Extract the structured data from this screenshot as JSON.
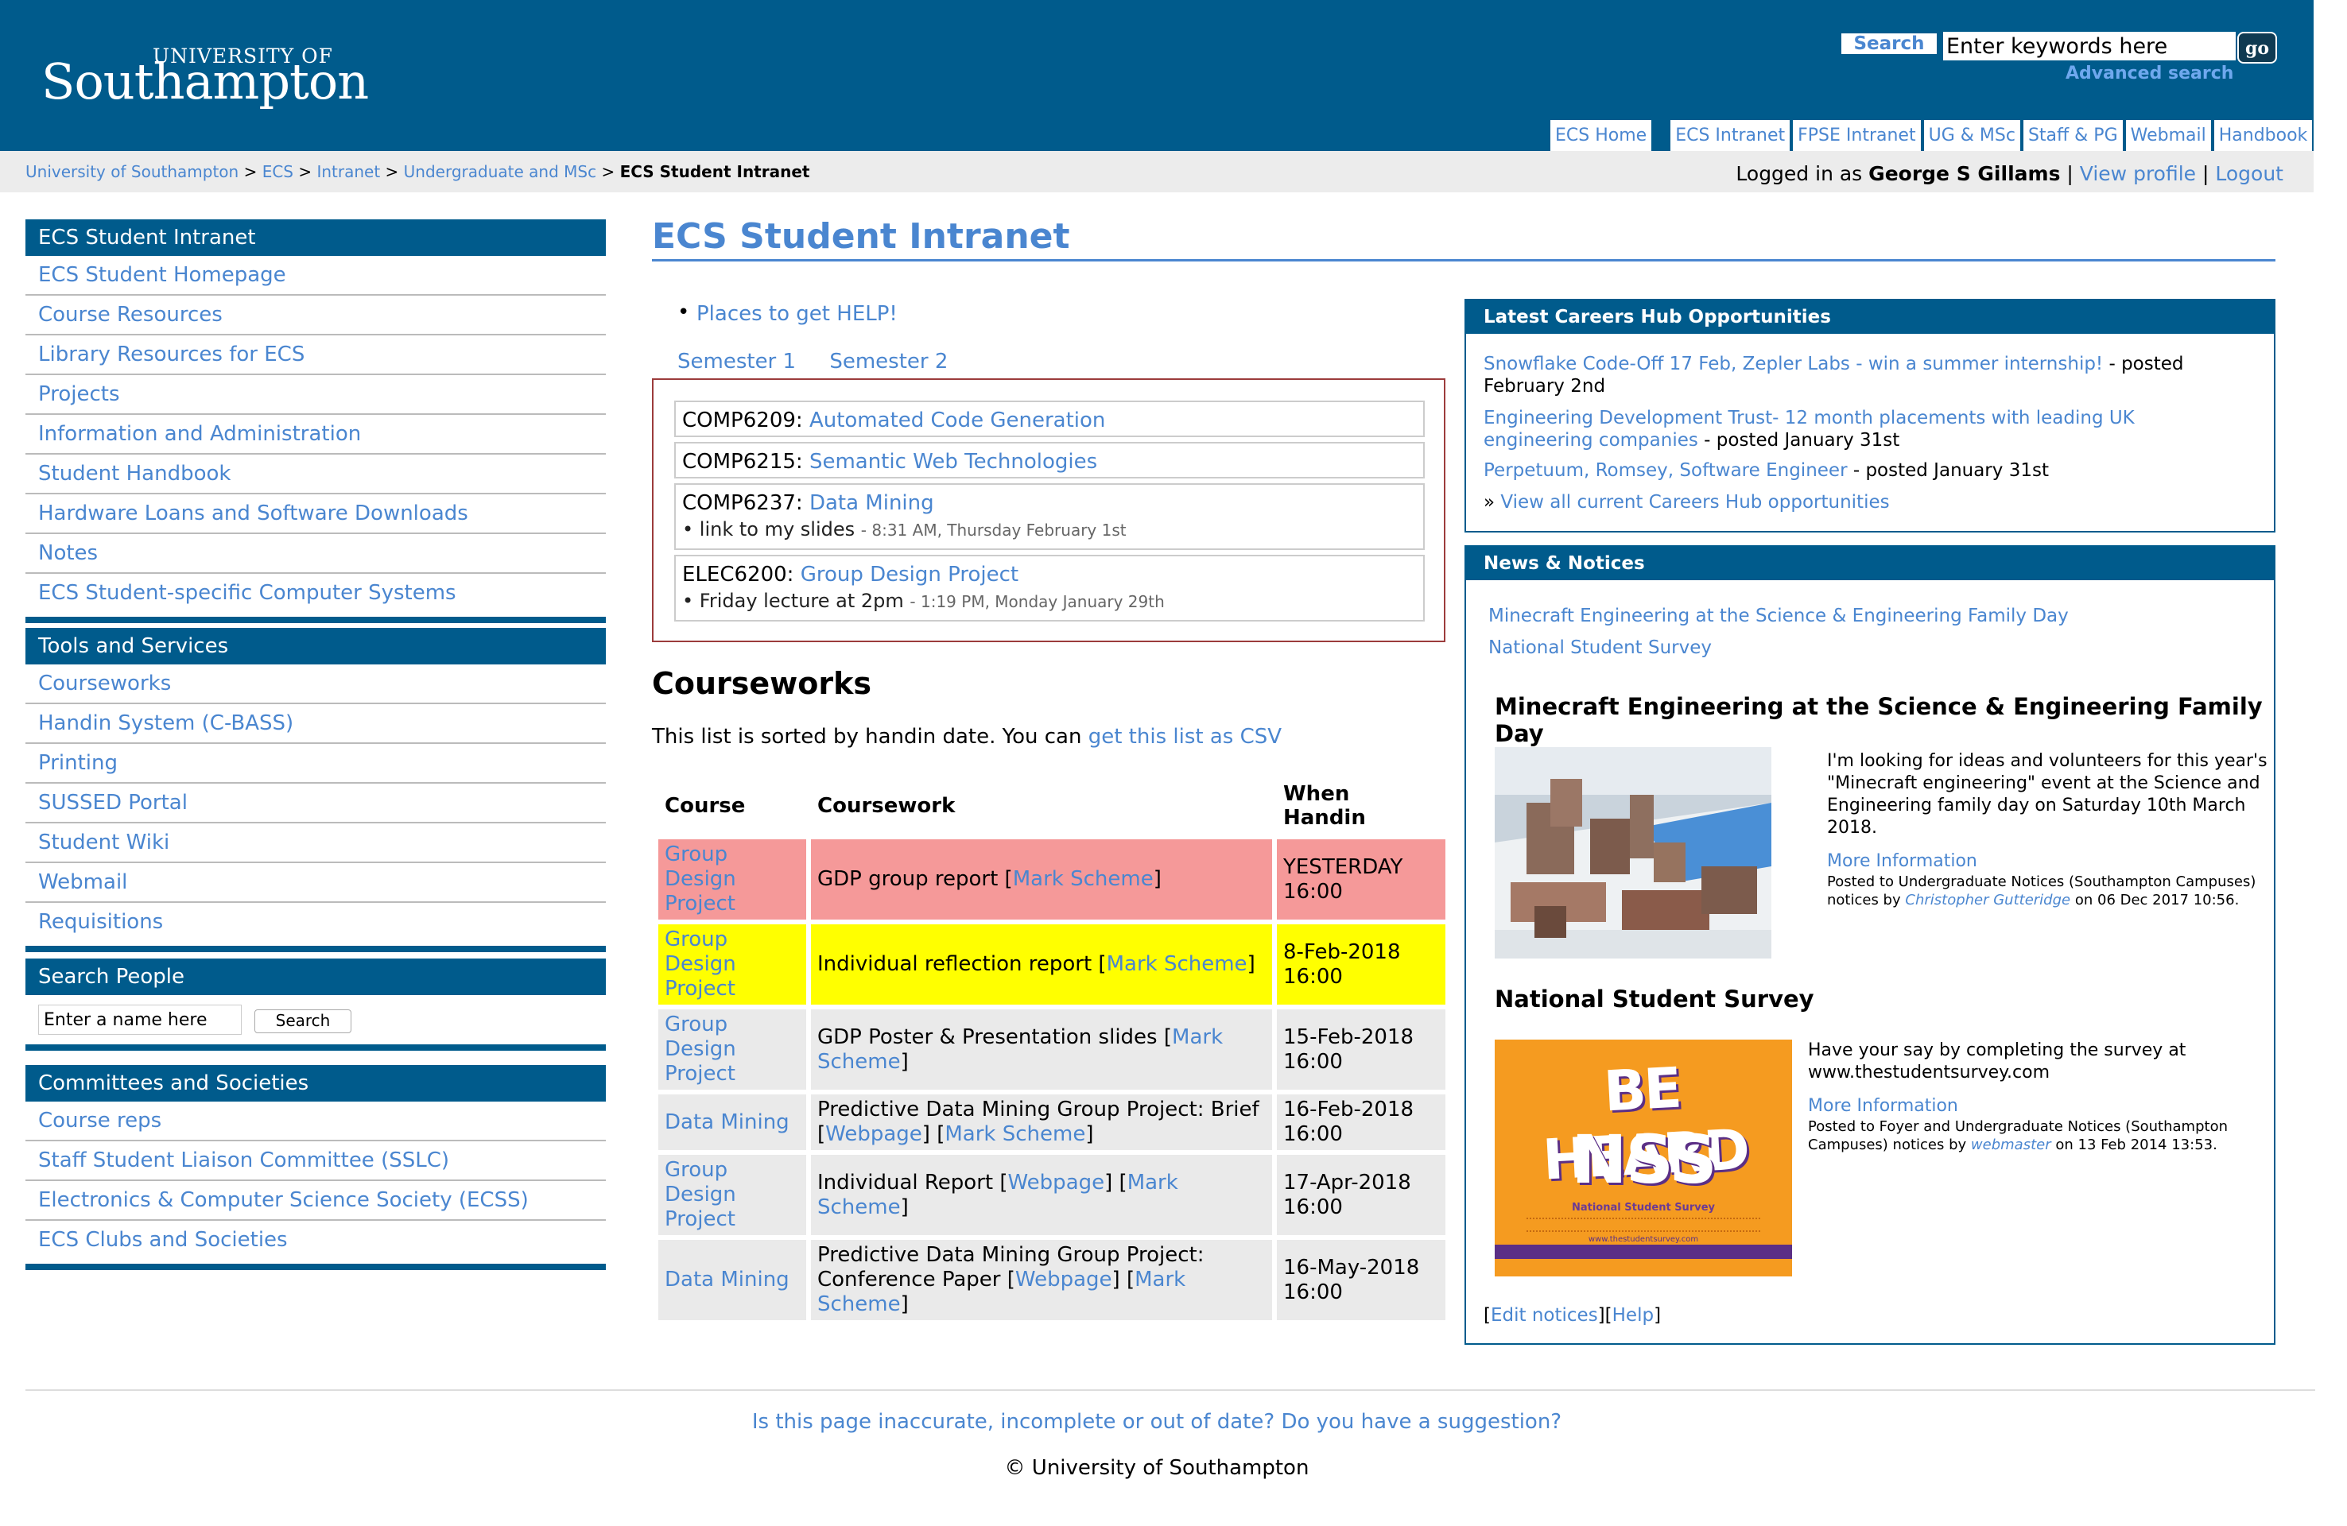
{
  "header": {
    "logo_top": "UNIVERSITY OF",
    "logo_main": "Southampton",
    "search_label": "Search",
    "search_placeholder": "Enter keywords here",
    "go_label": "go",
    "advanced_search": "Advanced search",
    "tabs": [
      "ECS Home",
      "ECS Intranet",
      "FPSE Intranet",
      "UG & MSc",
      "Staff & PG",
      "Webmail",
      "Handbook"
    ]
  },
  "breadcrumb": {
    "items": [
      "University of Southampton",
      "ECS",
      "Intranet",
      "Undergraduate and MSc"
    ],
    "separator": ">",
    "current": "ECS Student Intranet"
  },
  "login": {
    "prefix": "Logged in as",
    "user": "George S Gillams",
    "view_profile": "View profile",
    "logout": "Logout",
    "sep": "|"
  },
  "nav": {
    "intranet": {
      "title": "ECS Student Intranet",
      "items": [
        "ECS Student Homepage",
        "Course Resources",
        "Library Resources for ECS",
        "Projects",
        "Information and Administration",
        "Student Handbook",
        "Hardware Loans and Software Downloads",
        "Notes",
        "ECS Student-specific Computer Systems"
      ]
    },
    "tools": {
      "title": "Tools and Services",
      "items": [
        "Courseworks",
        "Handin System (C-BASS)",
        "Printing",
        "SUSSED Portal",
        "Student Wiki",
        "Webmail",
        "Requisitions"
      ]
    },
    "people": {
      "title": "Search People",
      "placeholder": "Enter a name here",
      "button": "Search"
    },
    "committees": {
      "title": "Committees and Societies",
      "items": [
        "Course reps",
        "Staff Student Liaison Committee (SSLC)",
        "Electronics & Computer Science Society (ECSS)",
        "ECS Clubs and Societies"
      ]
    }
  },
  "main": {
    "title": "ECS Student Intranet",
    "help_bullet": "•",
    "help_link": "Places to get HELP!",
    "semester_tabs": [
      "Semester 1",
      "Semester 2"
    ],
    "modules": [
      {
        "code": "COMP6209:",
        "name": "Automated Code Generation"
      },
      {
        "code": "COMP6215:",
        "name": "Semantic Web Technologies"
      },
      {
        "code": "COMP6237:",
        "name": "Data Mining",
        "note": "link to my slides",
        "note_time": "- 8:31 AM, Thursday February 1st"
      },
      {
        "code": "ELEC6200:",
        "name": "Group Design Project",
        "note": "Friday lecture at 2pm",
        "note_time": "- 1:19 PM, Monday January 29th"
      }
    ],
    "courseworks": {
      "title": "Courseworks",
      "sorted_text": "This list is sorted by handin date. You can",
      "csv_link": "get this list as CSV",
      "headers": [
        "Course",
        "Coursework",
        "When Handin"
      ],
      "rows": [
        {
          "course": "Group Design Project",
          "work": "GDP group report",
          "links": [
            "Mark Scheme"
          ],
          "when1": "YESTERDAY",
          "when2": "16:00"
        },
        {
          "course": "Group Design Project",
          "work": "Individual reflection report",
          "links": [
            "Mark Scheme"
          ],
          "when1": "8-Feb-2018",
          "when2": "16:00"
        },
        {
          "course": "Group Design Project",
          "work": "GDP Poster & Presentation slides",
          "links": [
            "Mark Scheme"
          ],
          "when1": "15-Feb-2018",
          "when2": "16:00"
        },
        {
          "course": "Data Mining",
          "work": "Predictive Data Mining Group Project: Brief",
          "links": [
            "Webpage",
            "Mark Scheme"
          ],
          "when1": "16-Feb-2018",
          "when2": "16:00"
        },
        {
          "course": "Group Design Project",
          "work": "Individual Report",
          "links": [
            "Webpage",
            "Mark Scheme"
          ],
          "when1": "17-Apr-2018",
          "when2": "16:00"
        },
        {
          "course": "Data Mining",
          "work": "Predictive Data Mining Group Project: Conference Paper",
          "links": [
            "Webpage",
            "Mark Scheme"
          ],
          "when1": "16-May-2018",
          "when2": "16:00"
        }
      ]
    }
  },
  "careers": {
    "title": "Latest Careers Hub Opportunities",
    "items": [
      {
        "link": "Snowflake Code-Off 17 Feb, Zepler Labs - win a summer internship!",
        "posted": " - posted February 2nd"
      },
      {
        "link": "Engineering Development Trust- 12 month placements with leading UK engineering companies",
        "posted": " - posted January 31st"
      },
      {
        "link": "Perpetuum, Romsey, Software Engineer",
        "posted": " - posted January 31st"
      }
    ],
    "view_all_prefix": "»",
    "view_all": "View all current Careers Hub opportunities"
  },
  "news": {
    "title": "News & Notices",
    "links": [
      "Minecraft Engineering at the Science & Engineering Family Day",
      "National Student Survey"
    ],
    "articles": [
      {
        "heading": "Minecraft Engineering at the Science & Engineering Family Day",
        "body": "I'm looking for ideas and volunteers for this year's \"Minecraft engineering\" event at the Science and Engineering family day on Saturday 10th March 2018.",
        "more": "More Information",
        "meta_pre": "Posted to Undergraduate Notices (Southampton Campuses) notices by",
        "author": "Christopher Gutteridge",
        "meta_post": "on 06 Dec 2017 10:56."
      },
      {
        "heading": "National Student Survey",
        "body": "Have your say by completing the survey at www.thestudentsurvey.com",
        "more": "More Information",
        "meta_pre": "Posted to Foyer and Undergraduate Notices (Southampton Campuses) notices by",
        "author": "webmaster",
        "meta_post": "on 13 Feb 2014 13:53."
      }
    ],
    "nss_poster": {
      "line1": "BE HEARD",
      "line2": "NSS",
      "line3": "National Student Survey",
      "url": "www.thestudentsurvey.com"
    },
    "edit_notices": "Edit notices",
    "help": "Help"
  },
  "footer": {
    "question": "Is this page inaccurate, incomplete or out of date? Do you have a suggestion?",
    "copyright": "© University of Southampton"
  },
  "colors": {
    "brand": "#005b8c",
    "link": "#4a86d0",
    "overdue": "#f59999",
    "soon": "#ffff00"
  }
}
